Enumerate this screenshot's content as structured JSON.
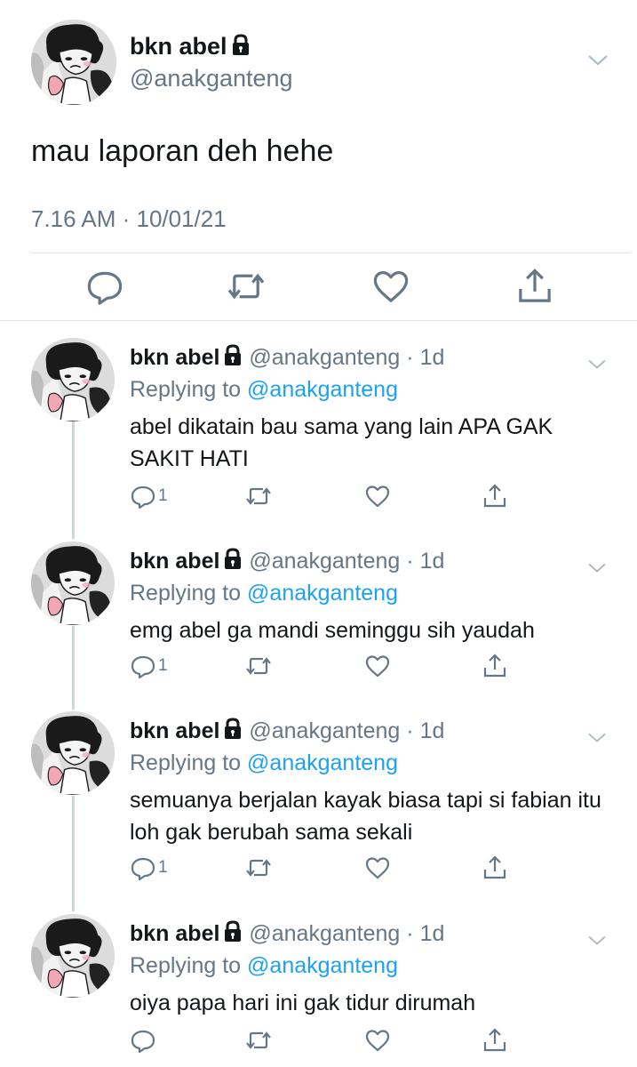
{
  "main_tweet": {
    "name": "bkn abel",
    "handle": "@anakganteng",
    "text": "mau laporan deh hehe",
    "timestamp": "7.16 AM · 10/01/21",
    "icons": [
      "avatar",
      "lock-icon",
      "chevron-down-icon",
      "reply-icon",
      "retweet-icon",
      "like-icon",
      "share-icon"
    ]
  },
  "replies": [
    {
      "name": "bkn abel",
      "handle": "@anakganteng",
      "age": "1d",
      "replying_prefix": "Replying to ",
      "replying_to": "@anakganteng",
      "text": "abel dikatain bau sama yang lain APA GAK SAKIT HATI",
      "reply_count": "1"
    },
    {
      "name": "bkn abel",
      "handle": "@anakganteng",
      "age": "1d",
      "replying_prefix": "Replying to ",
      "replying_to": "@anakganteng",
      "text": "emg abel ga mandi seminggu sih yaudah",
      "reply_count": "1"
    },
    {
      "name": "bkn abel",
      "handle": "@anakganteng",
      "age": "1d",
      "replying_prefix": "Replying to ",
      "replying_to": "@anakganteng",
      "text": "semuanya berjalan kayak biasa tapi si fabian itu loh gak berubah sama sekali",
      "reply_count": "1"
    },
    {
      "name": "bkn abel",
      "handle": "@anakganteng",
      "age": "1d",
      "replying_prefix": "Replying to ",
      "replying_to": "@anakganteng",
      "text": "oiya papa hari ini gak tidur dirumah",
      "reply_count": ""
    }
  ],
  "colors": {
    "text": "#14171a",
    "secondary": "#657786",
    "link": "#1da1f2",
    "divider": "#e1e8ed",
    "thread_line": "#ccd6dd"
  }
}
